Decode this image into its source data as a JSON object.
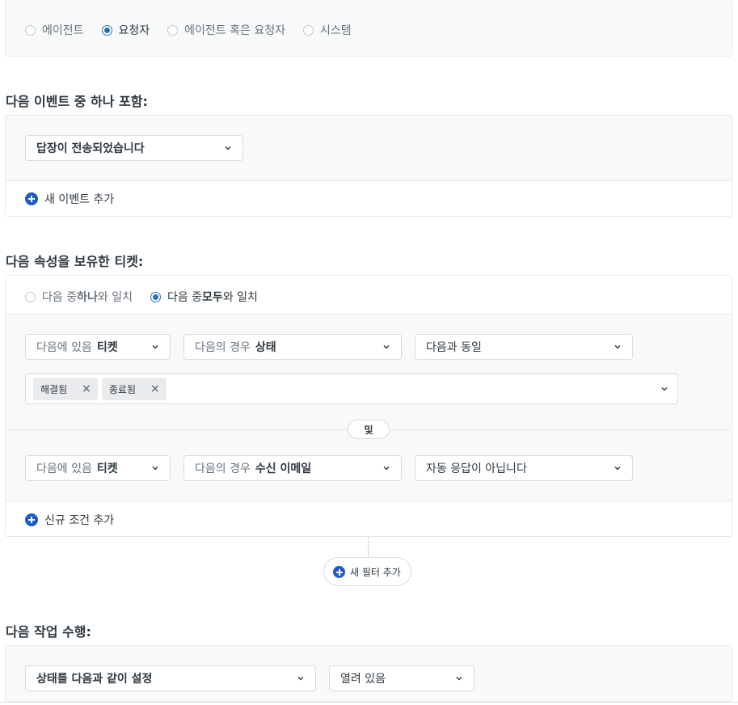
{
  "requester_scope": {
    "options": [
      "에이전트",
      "요청자",
      "에이전트 혹은 요청자",
      "시스템"
    ],
    "selected": "요청자"
  },
  "events_section": {
    "heading": "다음 이벤트 중 하나 포함:",
    "event_select": "답장이 전송되었습니다",
    "add_event_label": "새 이벤트 추가"
  },
  "tickets_section": {
    "heading": "다음 속성을 보유한 티켓:",
    "match_any_label_pre": "다음 중 ",
    "match_any_label_bold": "하나",
    "match_any_label_post": "와 일치",
    "match_all_label_pre": "다음 중 ",
    "match_all_label_bold": "모두",
    "match_all_label_post": "와 일치",
    "match_selected": "all",
    "condition1": {
      "object_pre": "다음에 있음",
      "object_val": "티켓",
      "field_pre": "다음의 경우",
      "field_val": "상태",
      "operator": "다음과 동일",
      "values": [
        "해결됨",
        "종료됨"
      ]
    },
    "and_label": "및",
    "condition2": {
      "object_pre": "다음에 있음",
      "object_val": "티켓",
      "field_pre": "다음의 경우",
      "field_val": "수신 이메일",
      "operator": "자동 응답이 아닙니다"
    },
    "add_condition_label": "신규 조건 추가"
  },
  "add_filter_label": "새 필터 추가",
  "actions_section": {
    "heading": "다음 작업 수행:",
    "action_select": "상태를 다음과 같이 설정",
    "value_select": "열려 있음"
  },
  "colors": {
    "accent": "#1f73b7",
    "plus_icon": "#1f5bc4",
    "panel_bg": "#f8f9f9",
    "border": "#d8dcde"
  }
}
